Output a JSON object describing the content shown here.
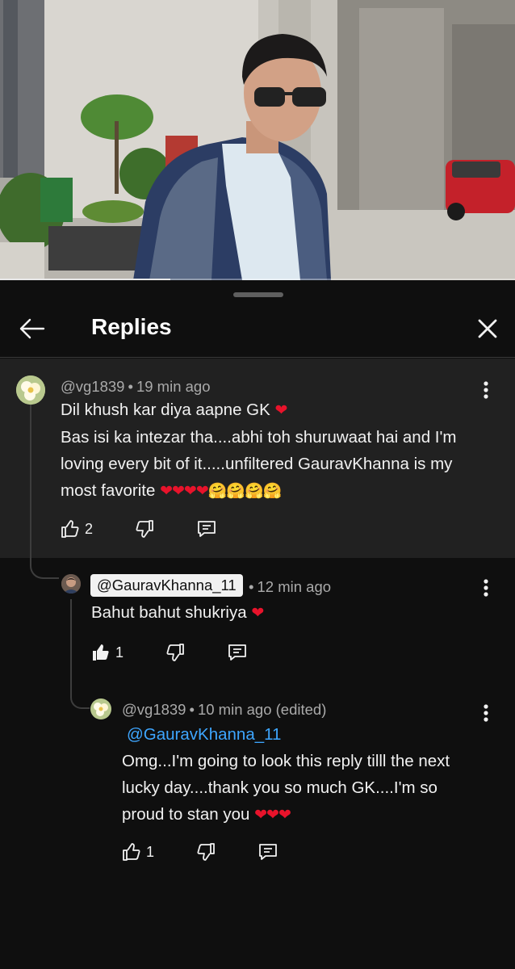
{
  "video": {
    "progress_fraction": 0.33
  },
  "header": {
    "title": "Replies"
  },
  "comments": [
    {
      "author": "@vg1839",
      "time": "19 min ago",
      "lines": [
        "Dil khush kar diya aapne GK",
        "Bas isi ka intezar tha....abhi toh shuruwaat hai and I'm",
        "loving every bit of it.....unfiltered GauravKhanna is my",
        "most favorite"
      ],
      "emoji_line1": "❤",
      "emoji_line4": "❤❤❤❤🤗🤗🤗🤗",
      "likes": "2"
    },
    {
      "author": "@GauravKhanna_11",
      "time": "12 min ago",
      "lines": [
        "Bahut bahut shukriya"
      ],
      "emoji_line1": "❤",
      "likes": "1"
    },
    {
      "author": "@vg1839",
      "time": "10 min ago (edited)",
      "mention": "@GauravKhanna_11",
      "lines": [
        "Omg...I'm going to look this reply tilll the next",
        "lucky day....thank you so much GK....I'm so",
        "proud to stan you"
      ],
      "emoji_line3": "❤❤❤",
      "likes": "1"
    }
  ],
  "icons": {
    "back": "arrow-left-icon",
    "close": "close-icon",
    "more": "more-vert-icon",
    "like": "thumb-up-icon",
    "dislike": "thumb-down-icon",
    "reply": "reply-comment-icon"
  },
  "colors": {
    "sheet_bg": "#0f0f0f",
    "highlight_bg": "#212121",
    "mention": "#3ea6ff",
    "heart": "#e8132b"
  }
}
